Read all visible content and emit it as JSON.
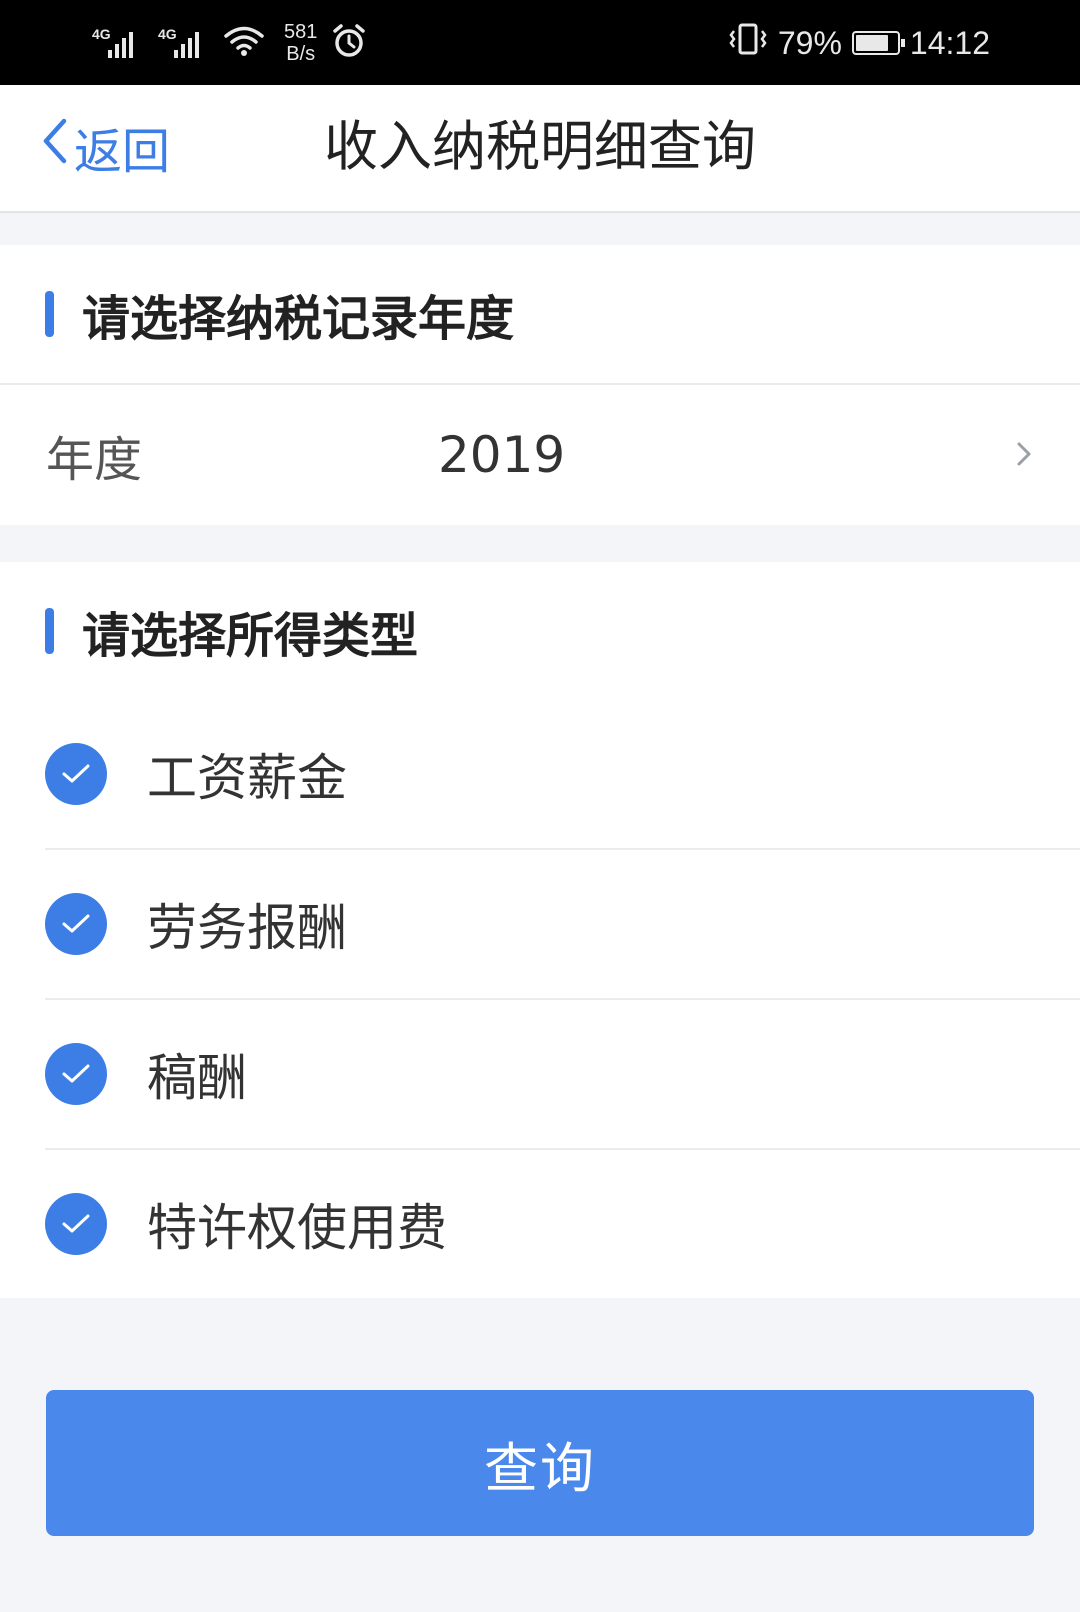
{
  "status_bar": {
    "network_1": "4G",
    "network_2": "4G",
    "speed_value": "581",
    "speed_unit": "B/s",
    "battery_percent": "79%",
    "battery_level": 0.79,
    "time": "14:12",
    "icons": [
      "signal-icon",
      "signal-icon",
      "wifi-icon",
      "alarm-icon",
      "vibrate-icon",
      "battery-icon"
    ]
  },
  "nav": {
    "back_label": "返回",
    "title": "收入纳税明细查询"
  },
  "year_section": {
    "title": "请选择纳税记录年度",
    "field_label": "年度",
    "field_value": "2019"
  },
  "type_section": {
    "title": "请选择所得类型",
    "items": [
      {
        "label": "工资薪金",
        "checked": true
      },
      {
        "label": "劳务报酬",
        "checked": true
      },
      {
        "label": "稿酬",
        "checked": true
      },
      {
        "label": "特许权使用费",
        "checked": true
      }
    ]
  },
  "query_button": "查询",
  "colors": {
    "accent": "#3d7ee6",
    "button": "#4a88ec",
    "page_bg": "#f3f5f8"
  }
}
